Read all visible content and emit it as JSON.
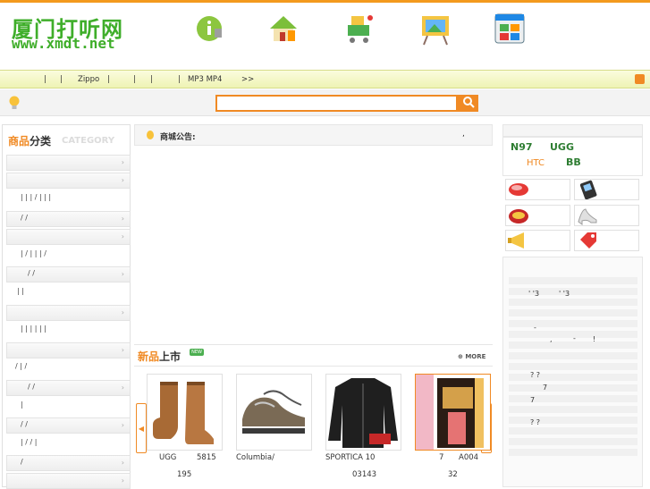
{
  "header": {
    "logo_cn": "厦门打听网",
    "logo_en": "www.xmdt.net",
    "icons": [
      "info-icon",
      "home-icon",
      "cart-icon",
      "easel-icon",
      "grid-icon"
    ]
  },
  "nav": {
    "items": [
      "|",
      "|",
      "Zippo",
      "|",
      "|",
      "|",
      "|",
      "MP3 MP4",
      ">>"
    ]
  },
  "search": {
    "placeholder": ""
  },
  "category": {
    "title_a": "商品",
    "title_b": "分类",
    "title_en": "CATEGORY",
    "subs": [
      "| | | / | | |",
      "/ /",
      "| / | | | /",
      "/ /",
      "| |",
      "| | | | | |",
      "/ | /",
      "/ /",
      "|",
      "/ /",
      "| / / |",
      "/"
    ]
  },
  "notice": {
    "label": "商城公告:",
    "tail": ","
  },
  "new_products": {
    "title_a": "新品",
    "title_b": "上市",
    "badge": "NEW",
    "more": "MORE",
    "items": [
      {
        "name": "UGG",
        "name2": "5815",
        "price": "195"
      },
      {
        "name": "Columbia/",
        "name2": "",
        "price": ""
      },
      {
        "name": "SPORTICA 10",
        "name2": "",
        "price": "03143"
      },
      {
        "name": "7",
        "name2": "A004",
        "price": "32"
      }
    ]
  },
  "brands": {
    "n97": "N97",
    "ugg": "UGG",
    "htc": "HTC",
    "bb": "BB"
  },
  "right_list": {
    "lines": [
      "' '3",
      "' '3",
      "-",
      ",",
      "-",
      "!",
      "? ?",
      "7",
      "7",
      "? ?"
    ]
  }
}
